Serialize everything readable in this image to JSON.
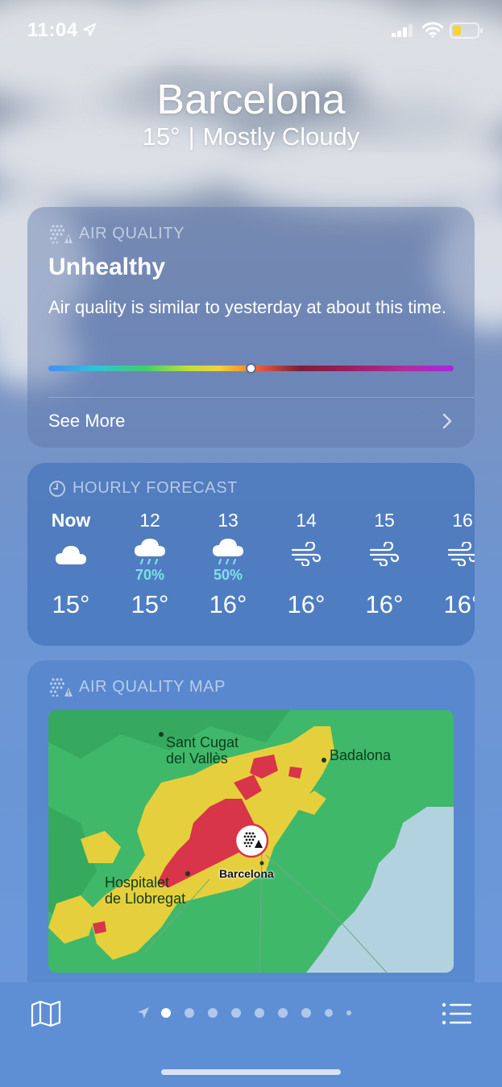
{
  "status_bar": {
    "time": "11:04",
    "icons": [
      "location-arrow-icon",
      "cellular-signal-icon",
      "wifi-icon",
      "battery-low-icon"
    ]
  },
  "header": {
    "city": "Barcelona",
    "temperature": "15°",
    "separator": "|",
    "condition": "Mostly Cloudy"
  },
  "air_quality": {
    "title": "AIR QUALITY",
    "level": "Unhealthy",
    "description": "Air quality is similar to yesterday at about this time.",
    "scale_position": 0.5,
    "see_more": "See More",
    "colors": {
      "good": "#3fd06a",
      "moderate": "#f2d23a",
      "unhealthy": "#e85a3a",
      "very_unhealthy": "#a428e0"
    }
  },
  "hourly": {
    "title": "HOURLY FORECAST",
    "hours": [
      {
        "label": "Now",
        "icon": "cloud-icon",
        "precip": "",
        "temp": "15°"
      },
      {
        "label": "12",
        "icon": "rain-cloud-icon",
        "precip": "70%",
        "temp": "15°"
      },
      {
        "label": "13",
        "icon": "rain-cloud-icon",
        "precip": "50%",
        "temp": "16°"
      },
      {
        "label": "14",
        "icon": "wind-icon",
        "precip": "",
        "temp": "16°"
      },
      {
        "label": "15",
        "icon": "wind-icon",
        "precip": "",
        "temp": "16°"
      },
      {
        "label": "16",
        "icon": "wind-icon",
        "precip": "",
        "temp": "16°"
      }
    ]
  },
  "air_quality_map": {
    "title": "AIR QUALITY MAP",
    "labels": {
      "sant_cugat_1": "Sant Cugat",
      "sant_cugat_2": "del Vallès",
      "badalona": "Badalona",
      "hospitalet_1": "Hospitalet",
      "hospitalet_2": "de Llobregat",
      "barcelona": "Barcelona"
    },
    "colors": {
      "land_good": "#3fb86a",
      "moderate": "#e6cf3c",
      "unhealthy": "#d8344a",
      "sea": "#b2d2df"
    }
  },
  "bottom_bar": {
    "page_count": 9,
    "current_page": 1
  }
}
